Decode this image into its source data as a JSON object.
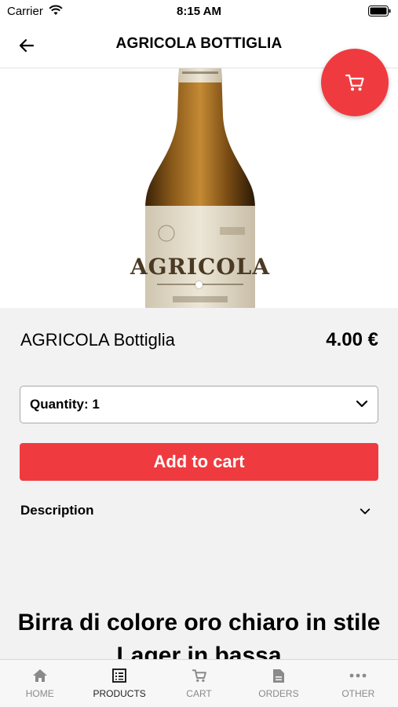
{
  "status_bar": {
    "carrier": "Carrier",
    "time": "8:15 AM"
  },
  "header": {
    "title": "AGRICOLA BOTTIGLIA"
  },
  "product": {
    "name": "AGRICOLA Bottiglia",
    "price": "4.00 €",
    "label_brand": "AGRICOLA"
  },
  "quantity": {
    "label": "Quantity: 1"
  },
  "actions": {
    "add_to_cart": "Add to cart"
  },
  "description": {
    "label": "Description",
    "text": "Birra di colore oro chiaro in stile Lager in bassa"
  },
  "tabs": [
    {
      "label": "HOME",
      "icon": "home-icon"
    },
    {
      "label": "PRODUCTS",
      "icon": "products-icon"
    },
    {
      "label": "CART",
      "icon": "cart-icon"
    },
    {
      "label": "ORDERS",
      "icon": "orders-icon"
    },
    {
      "label": "OTHER",
      "icon": "more-icon"
    }
  ],
  "colors": {
    "accent": "#ef3b3f",
    "background": "#f2f2f2",
    "active_tab": "#222222",
    "inactive_tab": "#8a8a8a"
  }
}
